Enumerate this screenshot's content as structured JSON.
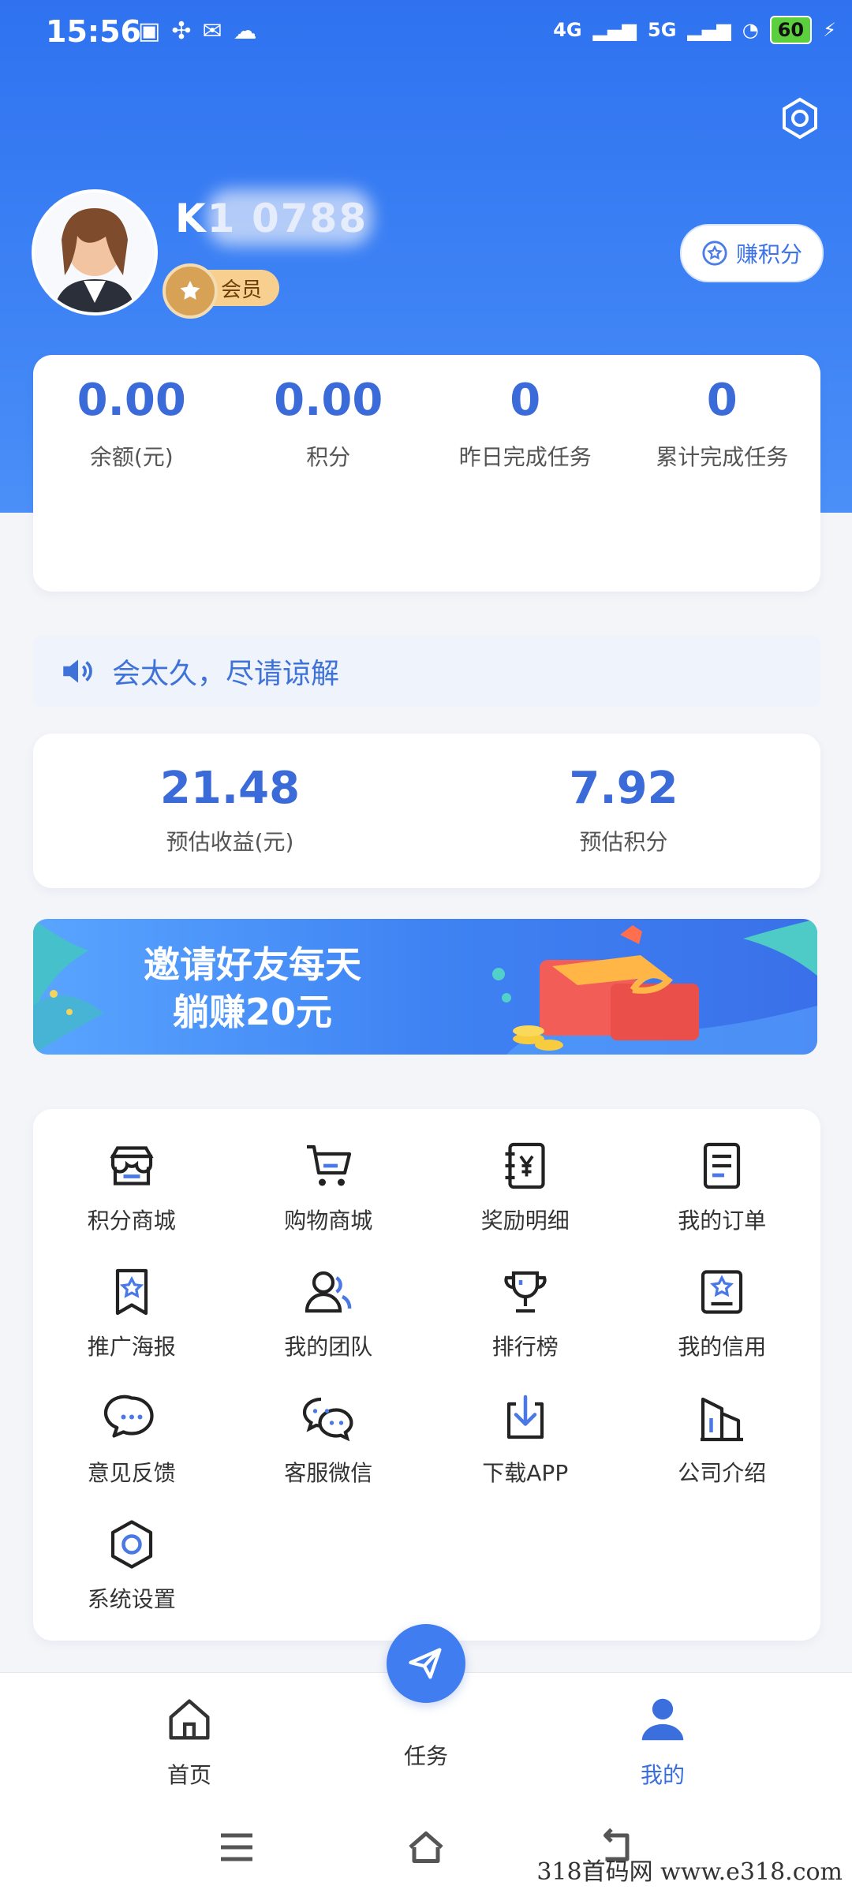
{
  "status": {
    "time": "15:56",
    "network": [
      "4G",
      "5G"
    ],
    "battery": "60"
  },
  "profile": {
    "username": "K1      0788",
    "member_label": "会员",
    "earn_points_button": "赚积分"
  },
  "stats": [
    {
      "value": "0.00",
      "label": "余额(元)"
    },
    {
      "value": "0.00",
      "label": "积分"
    },
    {
      "value": "0",
      "label": "昨日完成任务"
    },
    {
      "value": "0",
      "label": "累计完成任务"
    }
  ],
  "notice": {
    "text": "会太久，尽请谅解"
  },
  "estimates": [
    {
      "value": "21.48",
      "label": "预估收益(元)"
    },
    {
      "value": "7.92",
      "label": "预估积分"
    }
  ],
  "banner": {
    "line1": "邀请好友每天",
    "line2": "躺赚20元"
  },
  "menu": [
    {
      "label": "积分商城",
      "icon": "store-icon"
    },
    {
      "label": "购物商城",
      "icon": "cart-icon"
    },
    {
      "label": "奖励明细",
      "icon": "reward-detail-icon"
    },
    {
      "label": "我的订单",
      "icon": "order-icon"
    },
    {
      "label": "推广海报",
      "icon": "poster-icon"
    },
    {
      "label": "我的团队",
      "icon": "team-icon"
    },
    {
      "label": "排行榜",
      "icon": "trophy-icon"
    },
    {
      "label": "我的信用",
      "icon": "credit-icon"
    },
    {
      "label": "意见反馈",
      "icon": "feedback-icon"
    },
    {
      "label": "客服微信",
      "icon": "wechat-icon"
    },
    {
      "label": "下载APP",
      "icon": "download-icon"
    },
    {
      "label": "公司介绍",
      "icon": "company-icon"
    },
    {
      "label": "系统设置",
      "icon": "settings-icon"
    }
  ],
  "nav": {
    "home": "首页",
    "task": "任务",
    "mine": "我的"
  },
  "watermark": "318首码网   www.e318.com",
  "colors": {
    "primary": "#3b6ad9",
    "header": "#2f72f0",
    "badge": "#f7cf8e"
  }
}
